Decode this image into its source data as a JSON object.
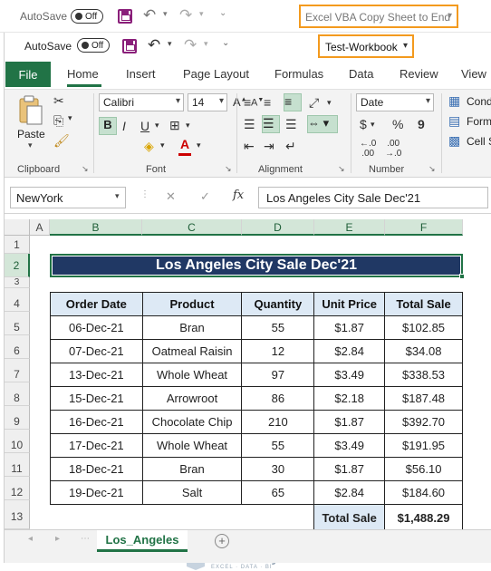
{
  "outer_window": {
    "autosave_label": "AutoSave",
    "autosave_state": "Off",
    "title": "Excel VBA Copy Sheet to End",
    "title_chevron": "▾"
  },
  "inner_window": {
    "autosave_label": "AutoSave",
    "autosave_state": "Off",
    "workbook_name": "Test-Workbook",
    "workbook_chevron": "▾"
  },
  "ribbon_tabs": [
    "File",
    "Home",
    "Insert",
    "Page Layout",
    "Formulas",
    "Data",
    "Review",
    "View"
  ],
  "active_tab": "Home",
  "ribbon": {
    "clipboard": {
      "paste_label": "Paste",
      "group_label": "Clipboard"
    },
    "font": {
      "family": "Calibri",
      "size": "14",
      "bold": "B",
      "italic": "I",
      "underline": "U",
      "font_color_letter": "A",
      "group_label": "Font"
    },
    "alignment": {
      "group_label": "Alignment"
    },
    "number": {
      "format": "Date",
      "currency": "$",
      "percent": "%",
      "comma": "9",
      "group_label": "Number"
    },
    "styles": {
      "items": [
        "Conditional Formatting",
        "Format as Table",
        "Cell Styles"
      ],
      "visible_items": [
        "Cond",
        "Form",
        "Cell S"
      ]
    }
  },
  "formula_bar": {
    "name_box": "NewYork",
    "fx_label": "fx",
    "cancel_symbol": "✕",
    "enter_symbol": "✓",
    "content": "Los Angeles City Sale Dec'21"
  },
  "grid": {
    "columns": [
      "A",
      "B",
      "C",
      "D",
      "E",
      "F"
    ],
    "selected_columns": [
      "B",
      "C",
      "D",
      "E",
      "F"
    ],
    "rows": [
      "1",
      "2",
      "3",
      "4",
      "5",
      "6",
      "7",
      "8",
      "9",
      "10",
      "11",
      "12",
      "13"
    ],
    "selected_row": "2",
    "title": "Los Angeles City Sale Dec'21",
    "headers": [
      "Order Date",
      "Product",
      "Quantity",
      "Unit Price",
      "Total Sale"
    ],
    "records": [
      [
        "06-Dec-21",
        "Bran",
        "55",
        "$1.87",
        "$102.85"
      ],
      [
        "07-Dec-21",
        "Oatmeal Raisin",
        "12",
        "$2.84",
        "$34.08"
      ],
      [
        "13-Dec-21",
        "Whole Wheat",
        "97",
        "$3.49",
        "$338.53"
      ],
      [
        "15-Dec-21",
        "Arrowroot",
        "86",
        "$2.18",
        "$187.48"
      ],
      [
        "16-Dec-21",
        "Chocolate Chip",
        "210",
        "$1.87",
        "$392.70"
      ],
      [
        "17-Dec-21",
        "Whole Wheat",
        "55",
        "$3.49",
        "$191.95"
      ],
      [
        "18-Dec-21",
        "Bran",
        "30",
        "$1.87",
        "$56.10"
      ],
      [
        "19-Dec-21",
        "Salt",
        "65",
        "$2.84",
        "$184.60"
      ]
    ],
    "total_label": "Total Sale",
    "total_value": "$1,488.29"
  },
  "sheet_tabs": {
    "active": "Los_Angeles",
    "add_symbol": "+"
  },
  "watermark": {
    "name": "exceldemy",
    "tagline": "EXCEL · DATA · BI"
  },
  "colors": {
    "excel_green": "#217346",
    "title_bar_fill": "#203864",
    "header_fill": "#dde9f5",
    "highlight_orange": "#f39a1e"
  }
}
